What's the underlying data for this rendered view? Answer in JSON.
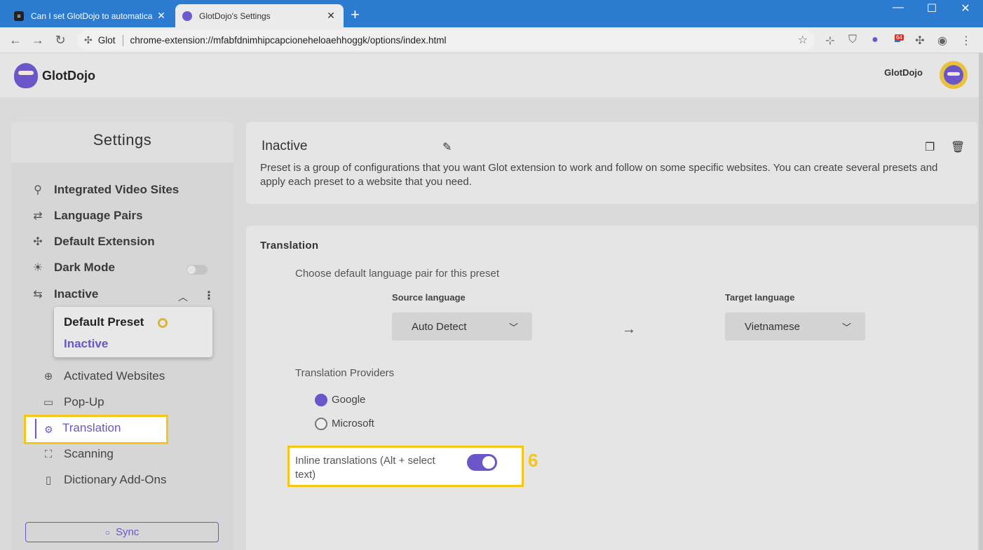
{
  "browser": {
    "tabs": [
      {
        "title": "Can I set GlotDojo to automatica",
        "close": "✕"
      },
      {
        "title": "GlotDojo's Settings",
        "close": "✕"
      }
    ],
    "new_tab": "+",
    "site_label": "Glot",
    "url": "chrome-extension://mfabfdnimhipcapcioneheloaehhoggk/options/index.html",
    "extension_badge": "64"
  },
  "header": {
    "brand": "GlotDojo",
    "user": "GlotDojo"
  },
  "sidebar": {
    "title": "Settings",
    "items": [
      {
        "label": "Integrated Video Sites",
        "icon": "search-icon"
      },
      {
        "label": "Language Pairs",
        "icon": "language-icon"
      },
      {
        "label": "Default Extension",
        "icon": "puzzle-icon"
      },
      {
        "label": "Dark Mode",
        "icon": "sunset-icon"
      },
      {
        "label": "Inactive",
        "icon": "repeat-icon"
      }
    ],
    "dark_mode_on": false,
    "preset_dropdown": {
      "items": [
        "Default Preset",
        "Inactive"
      ],
      "selected": "Inactive"
    },
    "sub_items": [
      {
        "label": "Activated Websites",
        "icon": "globe-icon"
      },
      {
        "label": "Pop-Up",
        "icon": "chat-bubble-icon"
      },
      {
        "label": "Translation",
        "icon": "translate-icon"
      },
      {
        "label": "Scanning",
        "icon": "scan-icon"
      },
      {
        "label": "Dictionary Add-Ons",
        "icon": "book-icon"
      }
    ],
    "sync_label": "Sync"
  },
  "preset": {
    "name": "Inactive",
    "description": "Preset is a group of configurations that you want Glot extension to work and follow on some specific websites. You can create several presets and apply each preset to a website that you need."
  },
  "translation": {
    "title": "Translation",
    "choose_label": "Choose default language pair for this preset",
    "source_label": "Source language",
    "source_value": "Auto Detect",
    "target_label": "Target language",
    "target_value": "Vietnamese",
    "providers_label": "Translation Providers",
    "providers": [
      "Google",
      "Microsoft"
    ],
    "selected_provider": "Google",
    "inline_label": "Inline translations (Alt + select text)",
    "inline_enabled": true,
    "step_marker": "6"
  },
  "colors": {
    "accent": "#6a56c8",
    "highlight": "#f5c518",
    "tabstrip": "#2b7cd0"
  }
}
